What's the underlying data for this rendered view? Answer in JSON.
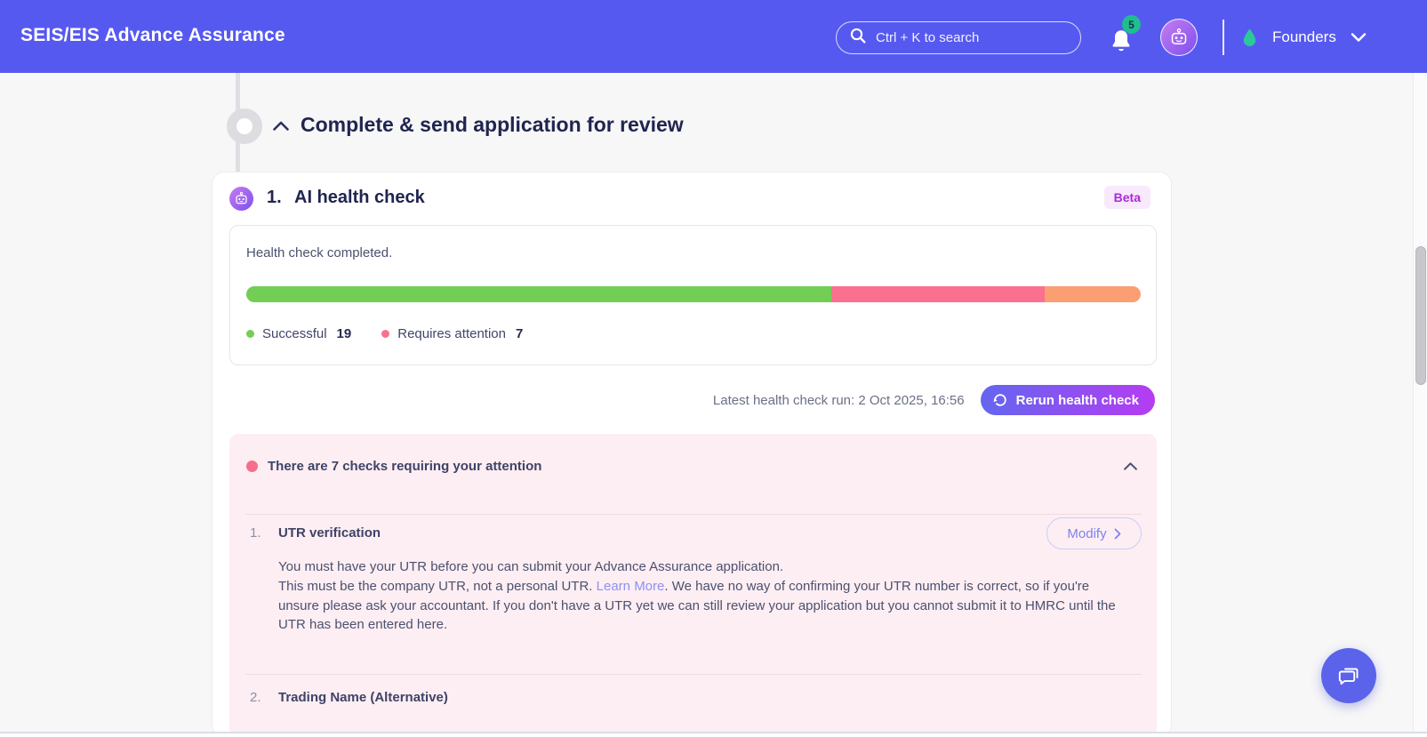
{
  "colors": {
    "header_bg": "#5659f0",
    "accent_green": "#72ce55",
    "accent_pink": "#f9718e",
    "accent_orange": "#fb9f73",
    "notification_badge_teal": "#1fbd8f",
    "beta_badge_text": "#a92bd7",
    "link_purple": "#8d92f4",
    "rerun_gradient_start": "#6366f0",
    "rerun_gradient_end": "#b53cf2"
  },
  "header": {
    "app_title": "SEIS/EIS Advance Assurance",
    "search_placeholder": "Ctrl + K to search",
    "notification_count": "5",
    "account_name": "Founders"
  },
  "section": {
    "title": "Complete & send application for review"
  },
  "health_check": {
    "step_number": "1.",
    "title": "AI health check",
    "beta_badge": "Beta",
    "status_text": "Health check completed.",
    "progress": {
      "successful_style": "width:65.4%",
      "attention_style": "width:23.9%",
      "warning_style": "width:10.7%"
    },
    "legend": {
      "successful_label": "Successful",
      "successful_count": "19",
      "attention_label": "Requires attention",
      "attention_count": "7"
    },
    "last_run": "Latest health check run: 2 Oct 2025, 16:56",
    "rerun_label": "Rerun health check"
  },
  "attention": {
    "header": "There are 7 checks requiring your attention",
    "items": [
      {
        "number": "1.",
        "title": "UTR verification",
        "action_label": "Modify",
        "body_line1": "You must have your UTR before you can submit your Advance Assurance application.",
        "body_line2_before_link": "This must be the company UTR, not a personal UTR. ",
        "body_link": "Learn More",
        "body_line2_after_link": ". We have no way of confirming your UTR number is correct, so if you're unsure please ask your accountant. If you don't have a UTR yet we can still review your application but you cannot submit it to HMRC until the UTR has been entered here."
      },
      {
        "number": "2.",
        "title": "Trading Name (Alternative)"
      }
    ]
  }
}
